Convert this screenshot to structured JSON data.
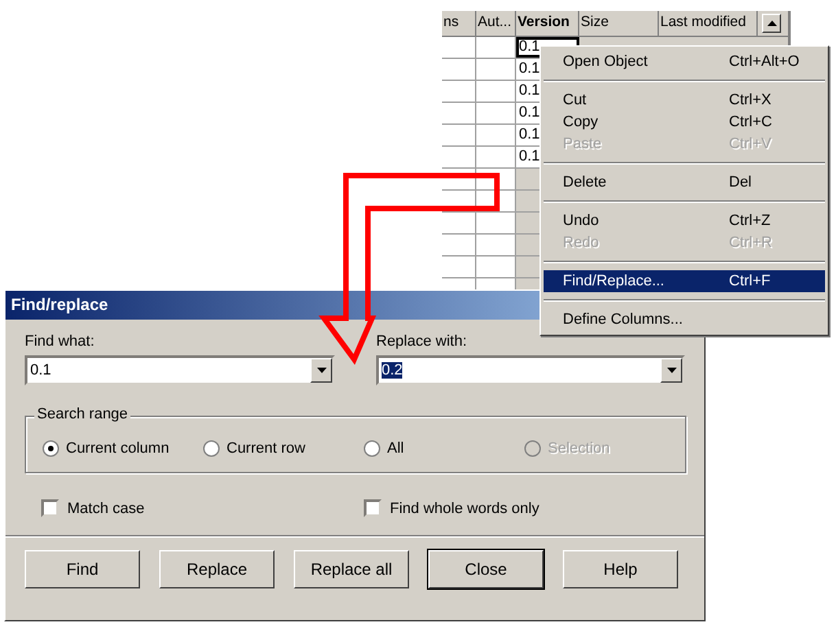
{
  "table": {
    "columns": [
      {
        "label": "ns",
        "bold": false
      },
      {
        "label": "Aut...",
        "bold": false
      },
      {
        "label": "Version",
        "bold": true
      },
      {
        "label": "Size",
        "bold": false
      },
      {
        "label": "Last modified",
        "bold": false
      }
    ],
    "rows": [
      {
        "version": "0.1",
        "selected": true
      },
      {
        "version": "0.1",
        "selected": false
      },
      {
        "version": "0.1",
        "selected": false
      },
      {
        "version": "0.1",
        "selected": false
      },
      {
        "version": "0.1",
        "selected": false
      },
      {
        "version": "0.1",
        "selected": false
      }
    ]
  },
  "context_menu": {
    "items": [
      {
        "kind": "item",
        "label": "Open Object",
        "shortcut": "Ctrl+Alt+O",
        "disabled": false,
        "selected": false
      },
      {
        "kind": "separator"
      },
      {
        "kind": "item",
        "label": "Cut",
        "shortcut": "Ctrl+X",
        "disabled": false,
        "selected": false
      },
      {
        "kind": "item",
        "label": "Copy",
        "shortcut": "Ctrl+C",
        "disabled": false,
        "selected": false
      },
      {
        "kind": "item",
        "label": "Paste",
        "shortcut": "Ctrl+V",
        "disabled": true,
        "selected": false
      },
      {
        "kind": "separator"
      },
      {
        "kind": "item",
        "label": "Delete",
        "shortcut": "Del",
        "disabled": false,
        "selected": false
      },
      {
        "kind": "separator"
      },
      {
        "kind": "item",
        "label": "Undo",
        "shortcut": "Ctrl+Z",
        "disabled": false,
        "selected": false
      },
      {
        "kind": "item",
        "label": "Redo",
        "shortcut": "Ctrl+R",
        "disabled": true,
        "selected": false
      },
      {
        "kind": "separator"
      },
      {
        "kind": "item",
        "label": "Find/Replace...",
        "shortcut": "Ctrl+F",
        "disabled": false,
        "selected": true
      },
      {
        "kind": "separator"
      },
      {
        "kind": "item",
        "label": "Define Columns...",
        "disabled": false,
        "selected": false
      }
    ]
  },
  "dialog": {
    "title": "Find/replace",
    "find_what": {
      "label": "Find what:",
      "value": "0.1"
    },
    "replace_with": {
      "label": "Replace with:",
      "value": "0.2",
      "text_selected": true
    },
    "search_range": {
      "label": "Search range",
      "options": [
        {
          "label": "Current column",
          "selected": true,
          "disabled": false
        },
        {
          "label": "Current row",
          "selected": false,
          "disabled": false
        },
        {
          "label": "All",
          "selected": false,
          "disabled": false
        },
        {
          "label": "Selection",
          "selected": false,
          "disabled": true
        }
      ]
    },
    "checkboxes": [
      {
        "label": "Match case",
        "checked": false
      },
      {
        "label": "Find whole words only",
        "checked": false
      }
    ],
    "buttons": [
      {
        "label": "Find",
        "default": false
      },
      {
        "label": "Replace",
        "default": false
      },
      {
        "label": "Replace all",
        "default": false
      },
      {
        "label": "Close",
        "default": true
      },
      {
        "label": "Help",
        "default": false
      }
    ]
  }
}
